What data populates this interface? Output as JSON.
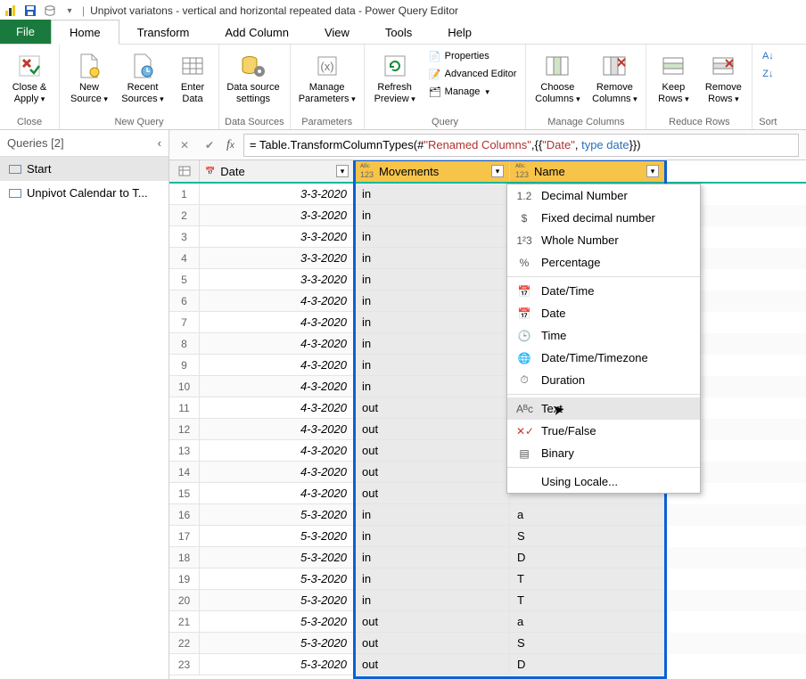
{
  "titlebar": {
    "title": "Unpivot variatons  - vertical and horizontal repeated data - Power Query Editor"
  },
  "tabs": {
    "file": "File",
    "home": "Home",
    "transform": "Transform",
    "addcol": "Add Column",
    "view": "View",
    "tools": "Tools",
    "help": "Help"
  },
  "ribbon": {
    "close": {
      "close_apply": "Close & Apply",
      "group": "Close"
    },
    "newquery": {
      "new_source": "New Source",
      "recent_sources": "Recent Sources",
      "enter_data": "Enter Data",
      "group": "New Query"
    },
    "datasources": {
      "ds_settings": "Data source settings",
      "group": "Data Sources"
    },
    "parameters": {
      "manage_params": "Manage Parameters",
      "group": "Parameters"
    },
    "query": {
      "refresh": "Refresh Preview",
      "properties": "Properties",
      "advanced": "Advanced Editor",
      "manage": "Manage",
      "group": "Query"
    },
    "managecols": {
      "choose": "Choose Columns",
      "remove": "Remove Columns",
      "group": "Manage Columns"
    },
    "reducerows": {
      "keep": "Keep Rows",
      "remove": "Remove Rows",
      "group": "Reduce Rows"
    },
    "sort": {
      "group": "Sort"
    }
  },
  "queries": {
    "header": "Queries [2]",
    "items": [
      {
        "label": "Start"
      },
      {
        "label": "Unpivot Calendar to T..."
      }
    ]
  },
  "formula": {
    "prefix": "= Table.TransformColumnTypes(#",
    "str1": "\"Renamed Columns\"",
    "mid": ",{{",
    "str2": "\"Date\"",
    "tail1": ", ",
    "kw": "type date",
    "tail2": "}})"
  },
  "columns": {
    "date": "Date",
    "movements": "Movements",
    "name": "Name"
  },
  "col_widths": {
    "date": 174,
    "movements": 174,
    "name": 174
  },
  "rows": [
    {
      "n": 1,
      "date": "3-3-2020",
      "mov": "in",
      "name": ""
    },
    {
      "n": 2,
      "date": "3-3-2020",
      "mov": "in",
      "name": ""
    },
    {
      "n": 3,
      "date": "3-3-2020",
      "mov": "in",
      "name": ""
    },
    {
      "n": 4,
      "date": "3-3-2020",
      "mov": "in",
      "name": ""
    },
    {
      "n": 5,
      "date": "3-3-2020",
      "mov": "in",
      "name": ""
    },
    {
      "n": 6,
      "date": "4-3-2020",
      "mov": "in",
      "name": ""
    },
    {
      "n": 7,
      "date": "4-3-2020",
      "mov": "in",
      "name": ""
    },
    {
      "n": 8,
      "date": "4-3-2020",
      "mov": "in",
      "name": ""
    },
    {
      "n": 9,
      "date": "4-3-2020",
      "mov": "in",
      "name": ""
    },
    {
      "n": 10,
      "date": "4-3-2020",
      "mov": "in",
      "name": ""
    },
    {
      "n": 11,
      "date": "4-3-2020",
      "mov": "out",
      "name": ""
    },
    {
      "n": 12,
      "date": "4-3-2020",
      "mov": "out",
      "name": ""
    },
    {
      "n": 13,
      "date": "4-3-2020",
      "mov": "out",
      "name": ""
    },
    {
      "n": 14,
      "date": "4-3-2020",
      "mov": "out",
      "name": ""
    },
    {
      "n": 15,
      "date": "4-3-2020",
      "mov": "out",
      "name": ""
    },
    {
      "n": 16,
      "date": "5-3-2020",
      "mov": "in",
      "name": "a"
    },
    {
      "n": 17,
      "date": "5-3-2020",
      "mov": "in",
      "name": "S"
    },
    {
      "n": 18,
      "date": "5-3-2020",
      "mov": "in",
      "name": "D"
    },
    {
      "n": 19,
      "date": "5-3-2020",
      "mov": "in",
      "name": "T"
    },
    {
      "n": 20,
      "date": "5-3-2020",
      "mov": "in",
      "name": "T"
    },
    {
      "n": 21,
      "date": "5-3-2020",
      "mov": "out",
      "name": "a"
    },
    {
      "n": 22,
      "date": "5-3-2020",
      "mov": "out",
      "name": "S"
    },
    {
      "n": 23,
      "date": "5-3-2020",
      "mov": "out",
      "name": "D"
    }
  ],
  "typemenu": {
    "decimal": "Decimal Number",
    "fixed": "Fixed decimal number",
    "whole": "Whole Number",
    "percentage": "Percentage",
    "datetime": "Date/Time",
    "date": "Date",
    "time": "Time",
    "dttz": "Date/Time/Timezone",
    "duration": "Duration",
    "text": "Text",
    "truefalse": "True/False",
    "binary": "Binary",
    "locale": "Using Locale..."
  }
}
